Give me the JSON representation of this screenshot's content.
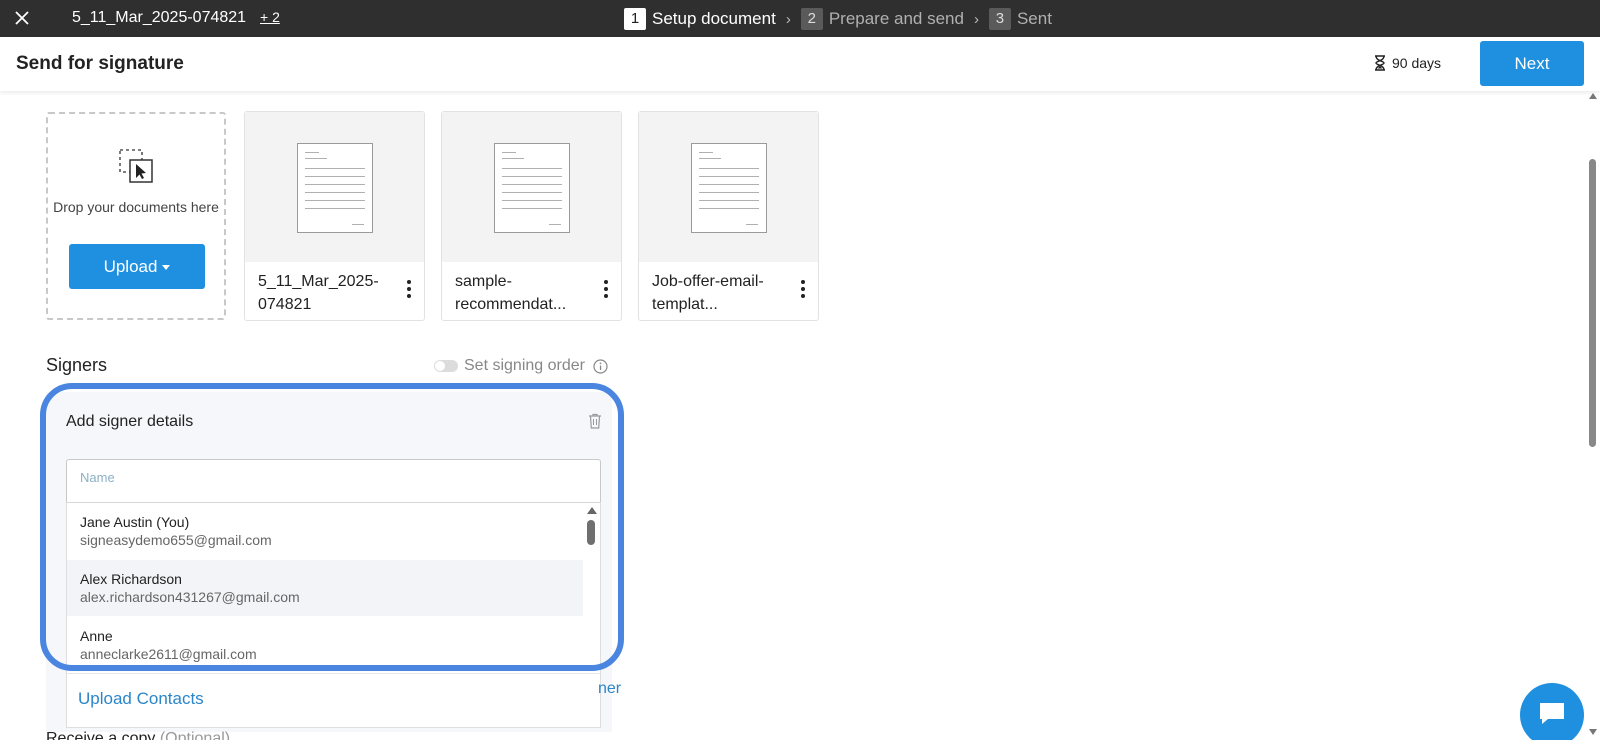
{
  "topbar": {
    "document_name": "5_11_Mar_2025-074821",
    "more_docs": "+ 2",
    "steps": [
      {
        "number": "1",
        "label": "Setup document",
        "state": "active"
      },
      {
        "number": "2",
        "label": "Prepare and send",
        "state": "inactive"
      },
      {
        "number": "3",
        "label": "Sent",
        "state": "inactive"
      }
    ],
    "separator": "›"
  },
  "header": {
    "title": "Send for signature",
    "expiry": "90 days",
    "next_label": "Next"
  },
  "dropzone": {
    "text": "Drop your documents here",
    "upload_label": "Upload"
  },
  "documents": [
    {
      "caption": "5_11_Mar_2025-074821"
    },
    {
      "caption": "sample-recommendat..."
    },
    {
      "caption": "Job-offer-email-templat..."
    }
  ],
  "signers": {
    "title": "Signers",
    "signing_order_label": "Set signing order",
    "panel_title": "Add signer details",
    "name_placeholder": "Name",
    "contacts": [
      {
        "name": "Jane Austin (You)",
        "email": "signeasydemo655@gmail.com"
      },
      {
        "name": "Alex Richardson",
        "email": "alex.richardson431267@gmail.com"
      },
      {
        "name": "Anne",
        "email": "anneclarke2611@gmail.com"
      }
    ],
    "upload_contacts": "Upload Contacts",
    "add_signer_partial": "ner"
  },
  "receive_copy": {
    "label": "Receive a copy",
    "optional": "(Optional)"
  },
  "colors": {
    "accent": "#1f8fe0",
    "highlight": "#4a86e0",
    "topbar": "#2f2f2f",
    "link": "#2b86c9"
  }
}
